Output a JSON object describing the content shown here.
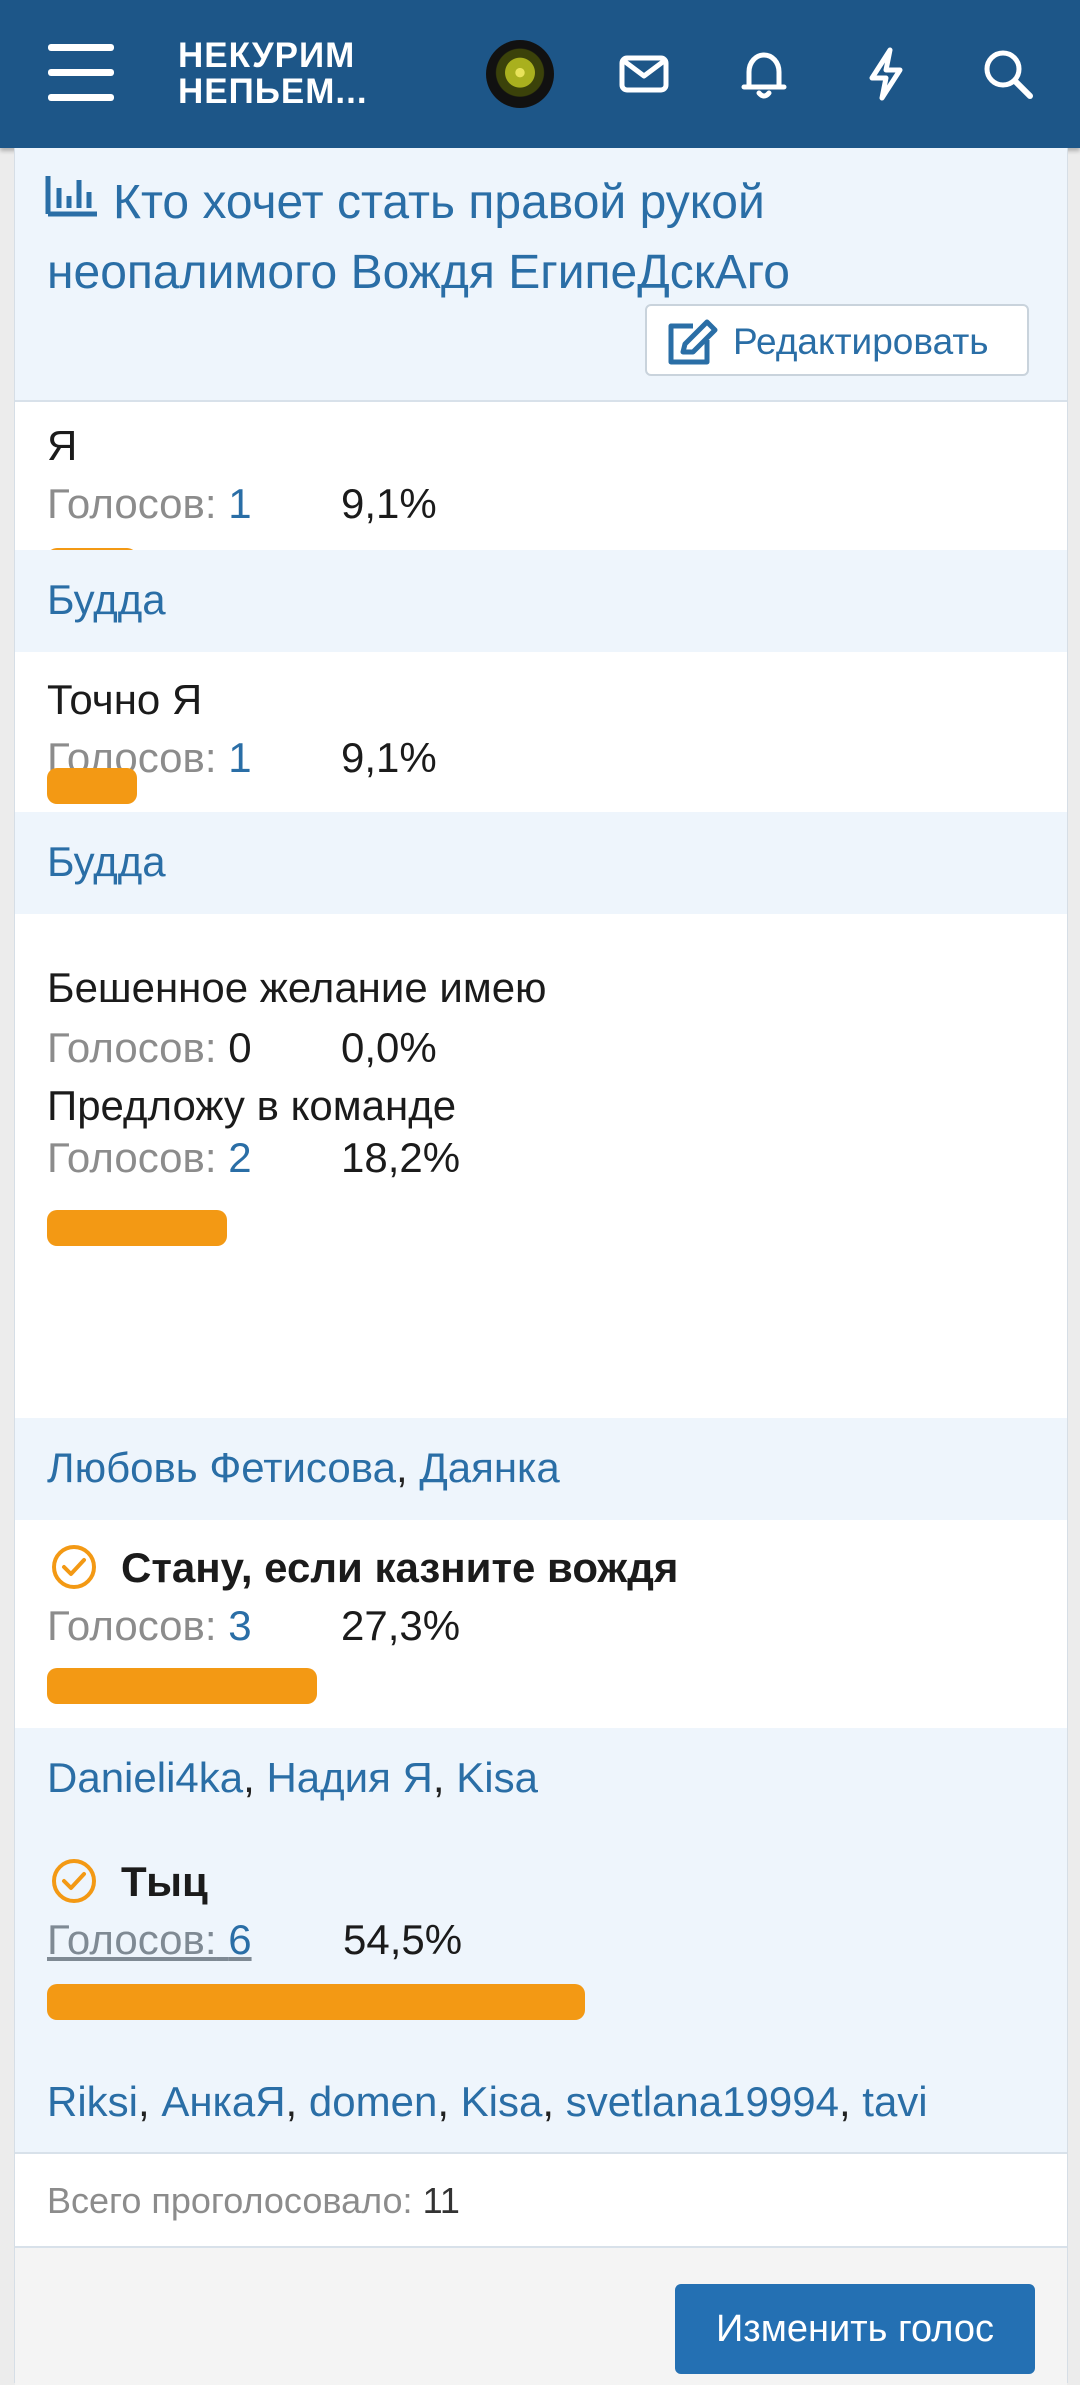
{
  "header": {
    "logo_line1": "НЕКУРИМ",
    "logo_line2": "НЕПЬЕМ...",
    "icons": [
      "menu-icon",
      "avatar",
      "mail-icon",
      "bell-icon",
      "bolt-icon",
      "search-icon"
    ],
    "bg_color": "#1d5688"
  },
  "poll": {
    "title": "Кто хочет стать правой рукой неопалимого Вождя ЕгипеДскАго",
    "edit_label": "Редактировать",
    "votes_label": "Голосов:",
    "options": [
      {
        "label": "Я",
        "votes": "1",
        "percent": "9,1%",
        "fill": 0.091,
        "voters": [
          "Будда"
        ]
      },
      {
        "label": "Точно Я",
        "votes": "1",
        "percent": "9,1%",
        "fill": 0.091,
        "voters": [
          "Будда"
        ]
      },
      {
        "label": "Бешенное желание имею",
        "votes": "0",
        "percent": "0,0%",
        "fill": 0.0,
        "voters": []
      },
      {
        "label": "Предложу в команде",
        "votes": "2",
        "percent": "18,2%",
        "fill": 0.182,
        "voters": [
          "Любовь Фетисова",
          "Даянка"
        ]
      },
      {
        "label": "Стану, если казните вождя",
        "votes": "3",
        "percent": "27,3%",
        "fill": 0.273,
        "selected": true,
        "voters": [
          "Danieli4ka",
          "Надия Я",
          "Kisa"
        ]
      },
      {
        "label": "Тыц",
        "votes": "6",
        "percent": "54,5%",
        "fill": 0.545,
        "selected": true,
        "voters": [
          "Riksi",
          "АнкаЯ",
          "domen",
          "Kisa",
          "svetlana19994",
          "tavi"
        ]
      }
    ],
    "total_label": "Всего проголосовало:",
    "total": "11",
    "change_vote_label": "Изменить голос",
    "bar_color": "#f39914",
    "link_color": "#2a6ea6"
  }
}
